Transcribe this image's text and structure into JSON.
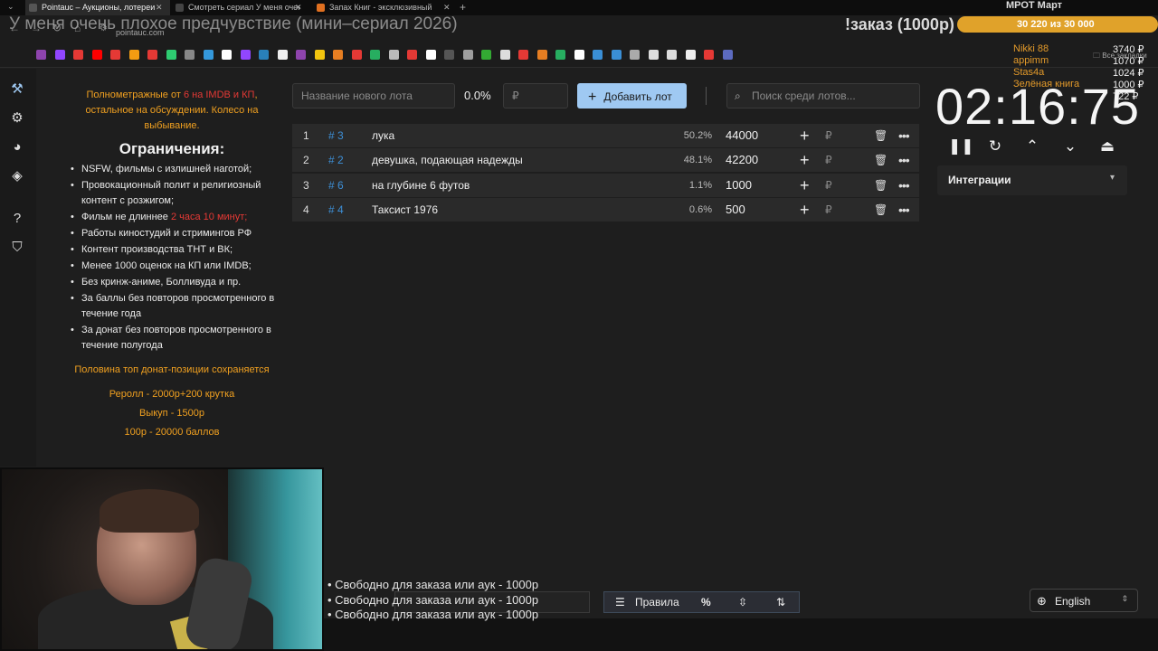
{
  "browser": {
    "tabs": [
      {
        "label": "Pointauc – Аукционы, лотереи",
        "active": true,
        "color": "#4a4a4a"
      },
      {
        "label": "Смотреть сериал У меня очен",
        "active": false,
        "color": "#444"
      },
      {
        "label": "Запах Книг - эксклюзивный",
        "active": false,
        "color": "#e07020"
      }
    ],
    "url": "pointauc.com",
    "all_bookmarks": "Все закладки"
  },
  "stream_overlay": {
    "title": "У меня очень плохое предчувствие (мини–сериал 2026)",
    "order_cmd": "!заказ (1000р)",
    "goal_title": "МРОТ Март",
    "goal_text": "30 220  из 30 000",
    "goal_progress": 1.0,
    "donors": [
      {
        "name": "Nikki 88",
        "amount": "3740 ₽"
      },
      {
        "name": "appimm",
        "amount": "1070 ₽"
      },
      {
        "name": "Stas4a",
        "amount": "1024 ₽"
      },
      {
        "name": "Зелёная книга",
        "amount": "1000 ₽"
      },
      {
        "name": "",
        "amount": "722 ₽"
      }
    ]
  },
  "rules": {
    "intro_pre": "Полнометражные от ",
    "intro_red": "6 на IMDB и КП",
    "intro_post": ", остальное на обсуждении. Колесо на выбывание.",
    "heading": "Ограничения:",
    "items": [
      "NSFW, фильмы с излишней наготой;",
      "Провокационный полит и религиозный контент с розжигом;",
      "Фильм не длиннее ",
      "Работы киностудий и стримингов РФ",
      "Контент производства ТНТ и ВК;",
      "Менее 1000 оценок на КП или IMDB;",
      "Без кринж-аниме, Болливуда и пр.",
      "За баллы без повторов просмотренного в течение года",
      "За донат без повторов просмотренного в течение полугода"
    ],
    "length_red": "2 часа 10 минут;",
    "note": "Половина топ донат-позиции сохраняется",
    "prices": [
      "Реролл - 2000р+200 крутка",
      "Выкуп - 1500р",
      "100р - 20000 баллов"
    ]
  },
  "lot_input": {
    "name_placeholder": "Название нового лота",
    "percent": "0.0%",
    "amount_placeholder": "₽",
    "add_label": "Добавить лот",
    "search_placeholder": "Поиск среди лотов..."
  },
  "lots": [
    {
      "index": "1",
      "id": "# 3",
      "name": "лука",
      "percent": "50.2%",
      "amount": "44000",
      "share": 0.502
    },
    {
      "index": "2",
      "id": "# 2",
      "name": "девушка, подающая надежды",
      "percent": "48.1%",
      "amount": "42200",
      "share": 0.481
    },
    {
      "index": "3",
      "id": "# 6",
      "name": "на глубине 6 футов",
      "percent": "1.1%",
      "amount": "1000",
      "share": 0.011
    },
    {
      "index": "4",
      "id": "# 4",
      "name": "Таксист 1976",
      "percent": "0.6%",
      "amount": "500",
      "share": 0.006
    }
  ],
  "timer": {
    "value": "02:16:75",
    "integrations_label": "Интеграции"
  },
  "bottom": {
    "free_lines": [
      "• Свободно для заказа или аук - 1000р",
      "• Свободно для заказа или аук - 1000р",
      "• Свободно для заказа или аук - 1000р"
    ],
    "rules_label": "Правила",
    "percent_symbol": "%",
    "language": "English"
  },
  "colors": {
    "accent": "#9fc9f2",
    "orange": "#f0a020",
    "red": "#e53935",
    "id_blue": "#3d8fd6"
  }
}
